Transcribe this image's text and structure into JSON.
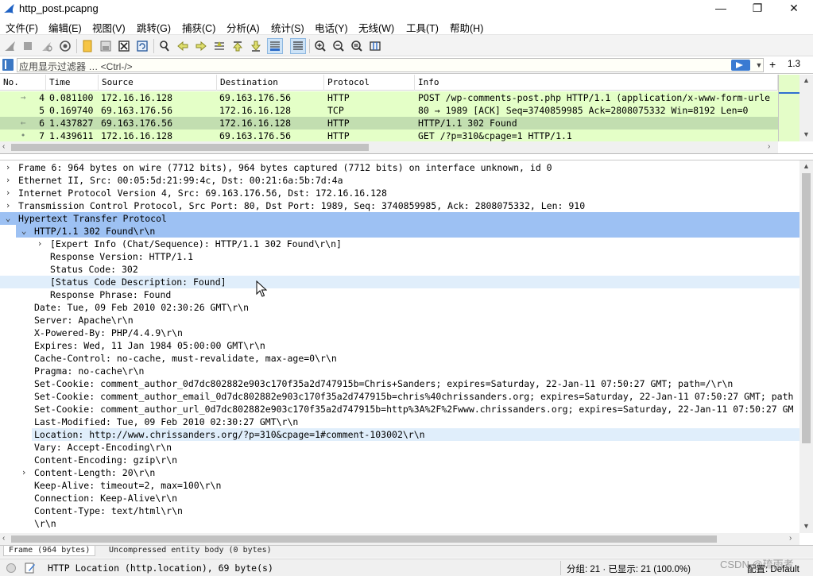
{
  "window": {
    "title": "http_post.pcapng",
    "minimize": "—",
    "maximize": "❐",
    "close": "✕"
  },
  "menu": [
    "文件(F)",
    "编辑(E)",
    "视图(V)",
    "跳转(G)",
    "捕获(C)",
    "分析(A)",
    "统计(S)",
    "电话(Y)",
    "无线(W)",
    "工具(T)",
    "帮助(H)"
  ],
  "filter": {
    "placeholder": "应用显示过滤器 … <Ctrl-/>",
    "add_label": "+",
    "version": "1.3"
  },
  "packet_list": {
    "columns": [
      "No.",
      "Time",
      "Source",
      "Destination",
      "Protocol",
      "Info"
    ],
    "rows": [
      {
        "no": "4",
        "time": "0.081100",
        "source": "172.16.16.128",
        "destination": "69.163.176.56",
        "protocol": "HTTP",
        "info": "POST /wp-comments-post.php HTTP/1.1  (application/x-www-form-urle",
        "rel": "→"
      },
      {
        "no": "5",
        "time": "0.169740",
        "source": "69.163.176.56",
        "destination": "172.16.16.128",
        "protocol": "TCP",
        "info": "80 → 1989 [ACK] Seq=3740859985 Ack=2808075332 Win=8192 Len=0",
        "rel": ""
      },
      {
        "no": "6",
        "time": "1.437827",
        "source": "69.163.176.56",
        "destination": "172.16.16.128",
        "protocol": "HTTP",
        "info": "HTTP/1.1 302 Found",
        "rel": "←"
      },
      {
        "no": "7",
        "time": "1.439611",
        "source": "172.16.16.128",
        "destination": "69.163.176.56",
        "protocol": "HTTP",
        "info": "GET /?p=310&cpage=1 HTTP/1.1",
        "rel": "•"
      }
    ]
  },
  "details": {
    "lines": [
      "Frame 6: 964 bytes on wire (7712 bits), 964 bytes captured (7712 bits) on interface unknown, id 0",
      "Ethernet II, Src: 00:05:5d:21:99:4c, Dst: 00:21:6a:5b:7d:4a",
      "Internet Protocol Version 4, Src: 69.163.176.56, Dst: 172.16.16.128",
      "Transmission Control Protocol, Src Port: 80, Dst Port: 1989, Seq: 3740859985, Ack: 2808075332, Len: 910",
      "Hypertext Transfer Protocol",
      "HTTP/1.1 302 Found\\r\\n",
      "[Expert Info (Chat/Sequence): HTTP/1.1 302 Found\\r\\n]",
      "Response Version: HTTP/1.1",
      "Status Code: 302",
      "[Status Code Description: Found]",
      "Response Phrase: Found",
      "Date: Tue, 09 Feb 2010 02:30:26 GMT\\r\\n",
      "Server: Apache\\r\\n",
      "X-Powered-By: PHP/4.4.9\\r\\n",
      "Expires: Wed, 11 Jan 1984 05:00:00 GMT\\r\\n",
      "Cache-Control: no-cache, must-revalidate, max-age=0\\r\\n",
      "Pragma: no-cache\\r\\n",
      "Set-Cookie: comment_author_0d7dc802882e903c170f35a2d747915b=Chris+Sanders; expires=Saturday, 22-Jan-11 07:50:27 GMT; path=/\\r\\n",
      "Set-Cookie: comment_author_email_0d7dc802882e903c170f35a2d747915b=chris%40chrissanders.org; expires=Saturday, 22-Jan-11 07:50:27 GMT; path",
      "Set-Cookie: comment_author_url_0d7dc802882e903c170f35a2d747915b=http%3A%2F%2Fwww.chrissanders.org; expires=Saturday, 22-Jan-11 07:50:27 GM",
      "Last-Modified: Tue, 09 Feb 2010 02:30:27 GMT\\r\\n",
      "Location: http://www.chrissanders.org/?p=310&cpage=1#comment-103002\\r\\n",
      "Vary: Accept-Encoding\\r\\n",
      "Content-Encoding: gzip\\r\\n",
      "Content-Length: 20\\r\\n",
      "Keep-Alive: timeout=2, max=100\\r\\n",
      "Connection: Keep-Alive\\r\\n",
      "Content-Type: text/html\\r\\n",
      "\\r\\n"
    ]
  },
  "byte_tabs": [
    "Frame (964 bytes)",
    "Uncompressed entity body (0 bytes)"
  ],
  "status": {
    "field": "HTTP Location (http.location), 69 byte(s)",
    "counts": "分组: 21 · 已显示: 21 (100.0%)",
    "profile": "配置: Default"
  },
  "watermark": "CSDN @琉雨者",
  "colors": {
    "http_row": "#e4ffc7",
    "selected_row": "#c2deb0",
    "protocol_highlight": "#9dc1f3",
    "field_highlight": "#e0eefb"
  },
  "icons": [
    "shark-fin-icon",
    "stop-icon",
    "restart-icon",
    "options-icon",
    "open-icon",
    "save-icon",
    "close-file-icon",
    "reload-icon",
    "find-icon",
    "back-icon",
    "forward-icon",
    "goto-icon",
    "first-icon",
    "last-icon",
    "autoscroll-icon",
    "colorize-icon",
    "zoom-in-icon",
    "zoom-out-icon",
    "zoom-reset-icon",
    "resize-columns-icon"
  ]
}
